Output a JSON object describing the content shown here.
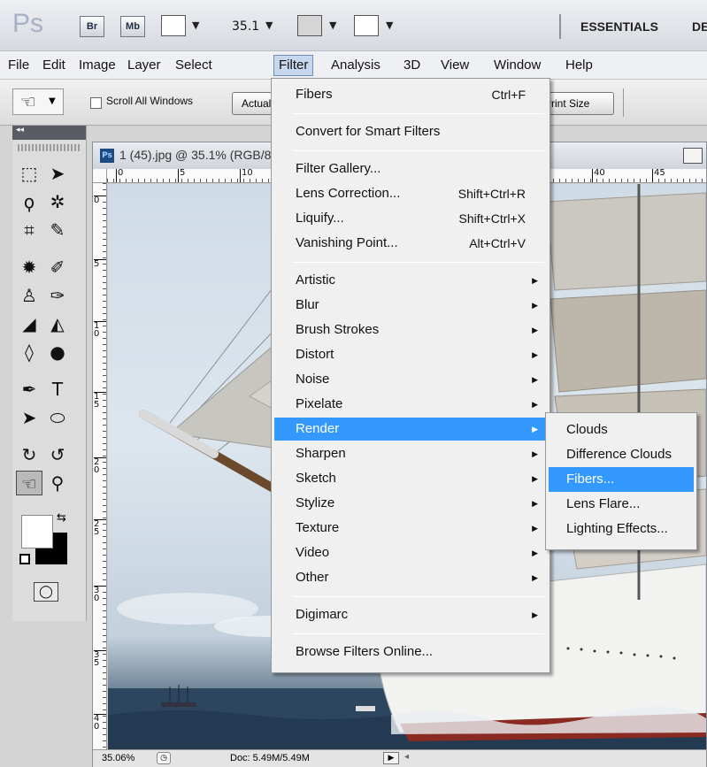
{
  "appbar": {
    "logo": "Ps",
    "bridge_label": "Br",
    "minibridge_label": "Mb",
    "zoom": "35.1",
    "workspace_active": "ESSENTIALS",
    "workspace_next": "DE"
  },
  "menubar": {
    "items": [
      "File",
      "Edit",
      "Image",
      "Layer",
      "Select",
      "Filter",
      "Analysis",
      "3D",
      "View",
      "Window",
      "Help"
    ],
    "active": "Filter"
  },
  "options": {
    "tool_icon": "hand-icon",
    "scroll_all_windows": "Scroll All Windows",
    "actual_pixels": "Actual Pixels",
    "print_size": "Print Size"
  },
  "tools_panel": {
    "collapse_label": "◂◂"
  },
  "document": {
    "badge": "Ps",
    "title": "1 (45).jpg @ 35.1% (RGB/8)",
    "ruler_top": [
      "0",
      "5",
      "10",
      "40",
      "45"
    ],
    "ruler_left": [
      "0",
      "5",
      "1\n0",
      "1\n5",
      "2\n0",
      "2\n5",
      "3\n0",
      "3\n5",
      "4\n0"
    ],
    "status_zoom": "35.06%",
    "status_doc": "Doc: 5.49M/5.49M"
  },
  "filter_menu": {
    "groups": [
      [
        {
          "label": "Fibers",
          "shortcut": "Ctrl+F"
        }
      ],
      [
        {
          "label": "Convert for Smart Filters"
        }
      ],
      [
        {
          "label": "Filter Gallery..."
        },
        {
          "label": "Lens Correction...",
          "shortcut": "Shift+Ctrl+R"
        },
        {
          "label": "Liquify...",
          "shortcut": "Shift+Ctrl+X"
        },
        {
          "label": "Vanishing Point...",
          "shortcut": "Alt+Ctrl+V"
        }
      ],
      [
        {
          "label": "Artistic",
          "submenu": true
        },
        {
          "label": "Blur",
          "submenu": true
        },
        {
          "label": "Brush Strokes",
          "submenu": true
        },
        {
          "label": "Distort",
          "submenu": true
        },
        {
          "label": "Noise",
          "submenu": true
        },
        {
          "label": "Pixelate",
          "submenu": true
        },
        {
          "label": "Render",
          "submenu": true,
          "highlighted": true
        },
        {
          "label": "Sharpen",
          "submenu": true
        },
        {
          "label": "Sketch",
          "submenu": true
        },
        {
          "label": "Stylize",
          "submenu": true
        },
        {
          "label": "Texture",
          "submenu": true
        },
        {
          "label": "Video",
          "submenu": true
        },
        {
          "label": "Other",
          "submenu": true
        }
      ],
      [
        {
          "label": "Digimarc",
          "submenu": true
        }
      ],
      [
        {
          "label": "Browse Filters Online..."
        }
      ]
    ]
  },
  "render_submenu": {
    "items": [
      {
        "label": "Clouds"
      },
      {
        "label": "Difference Clouds"
      },
      {
        "label": "Fibers...",
        "highlighted": true
      },
      {
        "label": "Lens Flare..."
      },
      {
        "label": "Lighting Effects..."
      }
    ]
  },
  "colors": {
    "highlight": "#3399ff",
    "menu_bg": "#f0f0f0",
    "active_menu_bg": "#c6d7ee"
  }
}
